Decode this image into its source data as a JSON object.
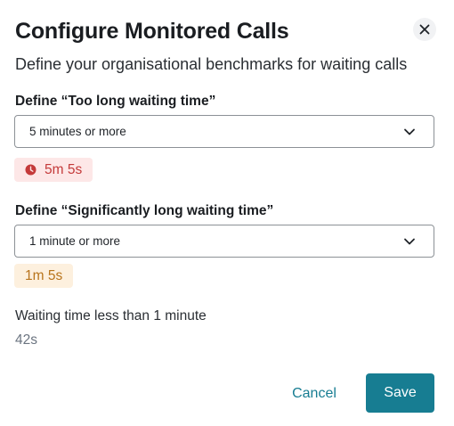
{
  "dialog": {
    "title": "Configure Monitored Calls",
    "subtitle": "Define your organisational benchmarks for waiting calls",
    "close_icon": "close-icon"
  },
  "too_long": {
    "label": "Define “Too long waiting time”",
    "selected": "5 minutes or more",
    "badge_icon": "clock-icon",
    "badge_value": "5m 5s",
    "badge_color": "#c43a3a",
    "badge_bg": "#fde7e7"
  },
  "significantly_long": {
    "label": "Define “Significantly long waiting time”",
    "selected": "1 minute or more",
    "badge_value": "1m 5s",
    "badge_color": "#b8741c",
    "badge_bg": "#fdf0de"
  },
  "short_wait": {
    "label": "Waiting time less than 1 minute",
    "value": "42s"
  },
  "actions": {
    "cancel_label": "Cancel",
    "save_label": "Save",
    "accent_color": "#177d92"
  }
}
